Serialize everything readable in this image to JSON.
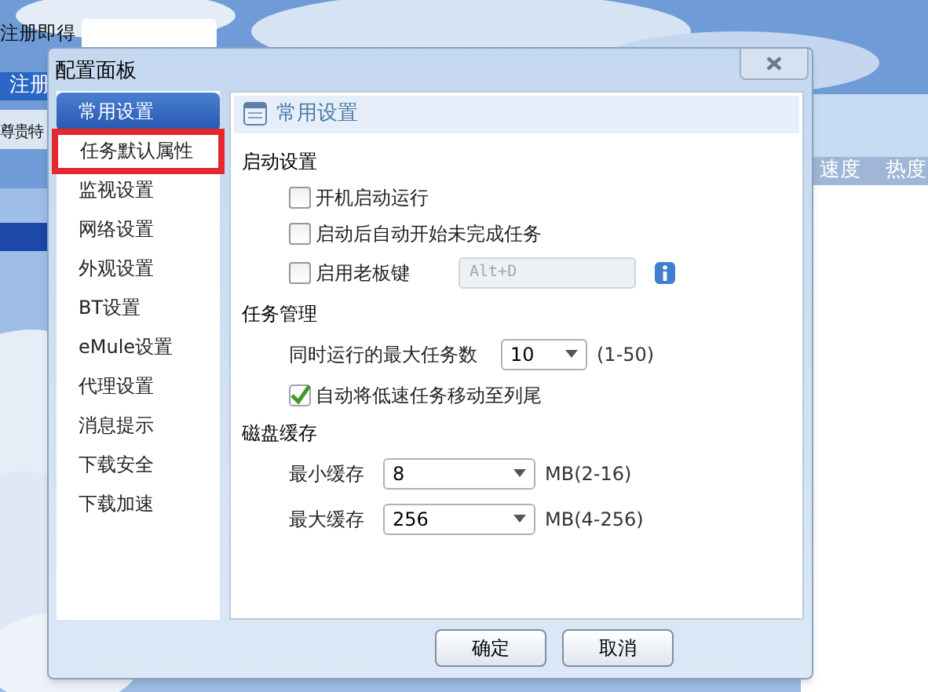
{
  "background": {
    "top_label": "注册即得",
    "register_button": "注册",
    "privilege_label": "尊贵特",
    "columns": [
      "速度",
      "热度"
    ]
  },
  "dialog": {
    "title": "配置面板",
    "sidebar": [
      {
        "label": "常用设置",
        "selected": true,
        "highlighted": false
      },
      {
        "label": "任务默认属性",
        "selected": false,
        "highlighted": true
      },
      {
        "label": "监视设置",
        "selected": false,
        "highlighted": false
      },
      {
        "label": "网络设置",
        "selected": false,
        "highlighted": false
      },
      {
        "label": "外观设置",
        "selected": false,
        "highlighted": false
      },
      {
        "label": "BT设置",
        "selected": false,
        "highlighted": false
      },
      {
        "label": "eMule设置",
        "selected": false,
        "highlighted": false
      },
      {
        "label": "代理设置",
        "selected": false,
        "highlighted": false
      },
      {
        "label": "消息提示",
        "selected": false,
        "highlighted": false
      },
      {
        "label": "下载安全",
        "selected": false,
        "highlighted": false
      },
      {
        "label": "下载加速",
        "selected": false,
        "highlighted": false
      }
    ],
    "panel_title": "常用设置",
    "sections": [
      {
        "title": "启动设置",
        "rows": [
          {
            "kind": "checkbox",
            "label": "开机启动运行",
            "checked": false
          },
          {
            "kind": "checkbox",
            "label": "启动后自动开始未完成任务",
            "checked": false
          },
          {
            "kind": "hotkey",
            "label": "启用老板键",
            "checked": false,
            "value": "Alt+D",
            "disabled": true
          }
        ]
      },
      {
        "title": "任务管理",
        "rows": [
          {
            "kind": "count_select",
            "label": "同时运行的最大任务数",
            "value": "10",
            "range": "(1-50)"
          },
          {
            "kind": "checkbox",
            "label": "自动将低速任务移动至列尾",
            "checked": true
          }
        ]
      },
      {
        "title": "磁盘缓存",
        "rows": [
          {
            "kind": "size_select",
            "label": "最小缓存",
            "value": "8",
            "range": "MB(2-16)"
          },
          {
            "kind": "size_select",
            "label": "最大缓存",
            "value": "256",
            "range": "MB(4-256)"
          }
        ]
      }
    ],
    "buttons": [
      "确定",
      "取消"
    ]
  }
}
